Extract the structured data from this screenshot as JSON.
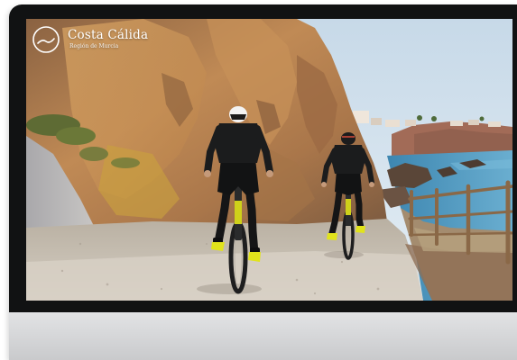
{
  "brand": {
    "title": "Costa Cálida",
    "subtitle": "Región de Murcia"
  },
  "scene": {
    "description_icon": "video-frame",
    "subjects": [
      "cyclist",
      "cyclist"
    ]
  },
  "colors": {
    "bezel": "#111213",
    "chin": "#d6d7d9",
    "sea": "#4f93b8",
    "rock": "#b8804c"
  }
}
